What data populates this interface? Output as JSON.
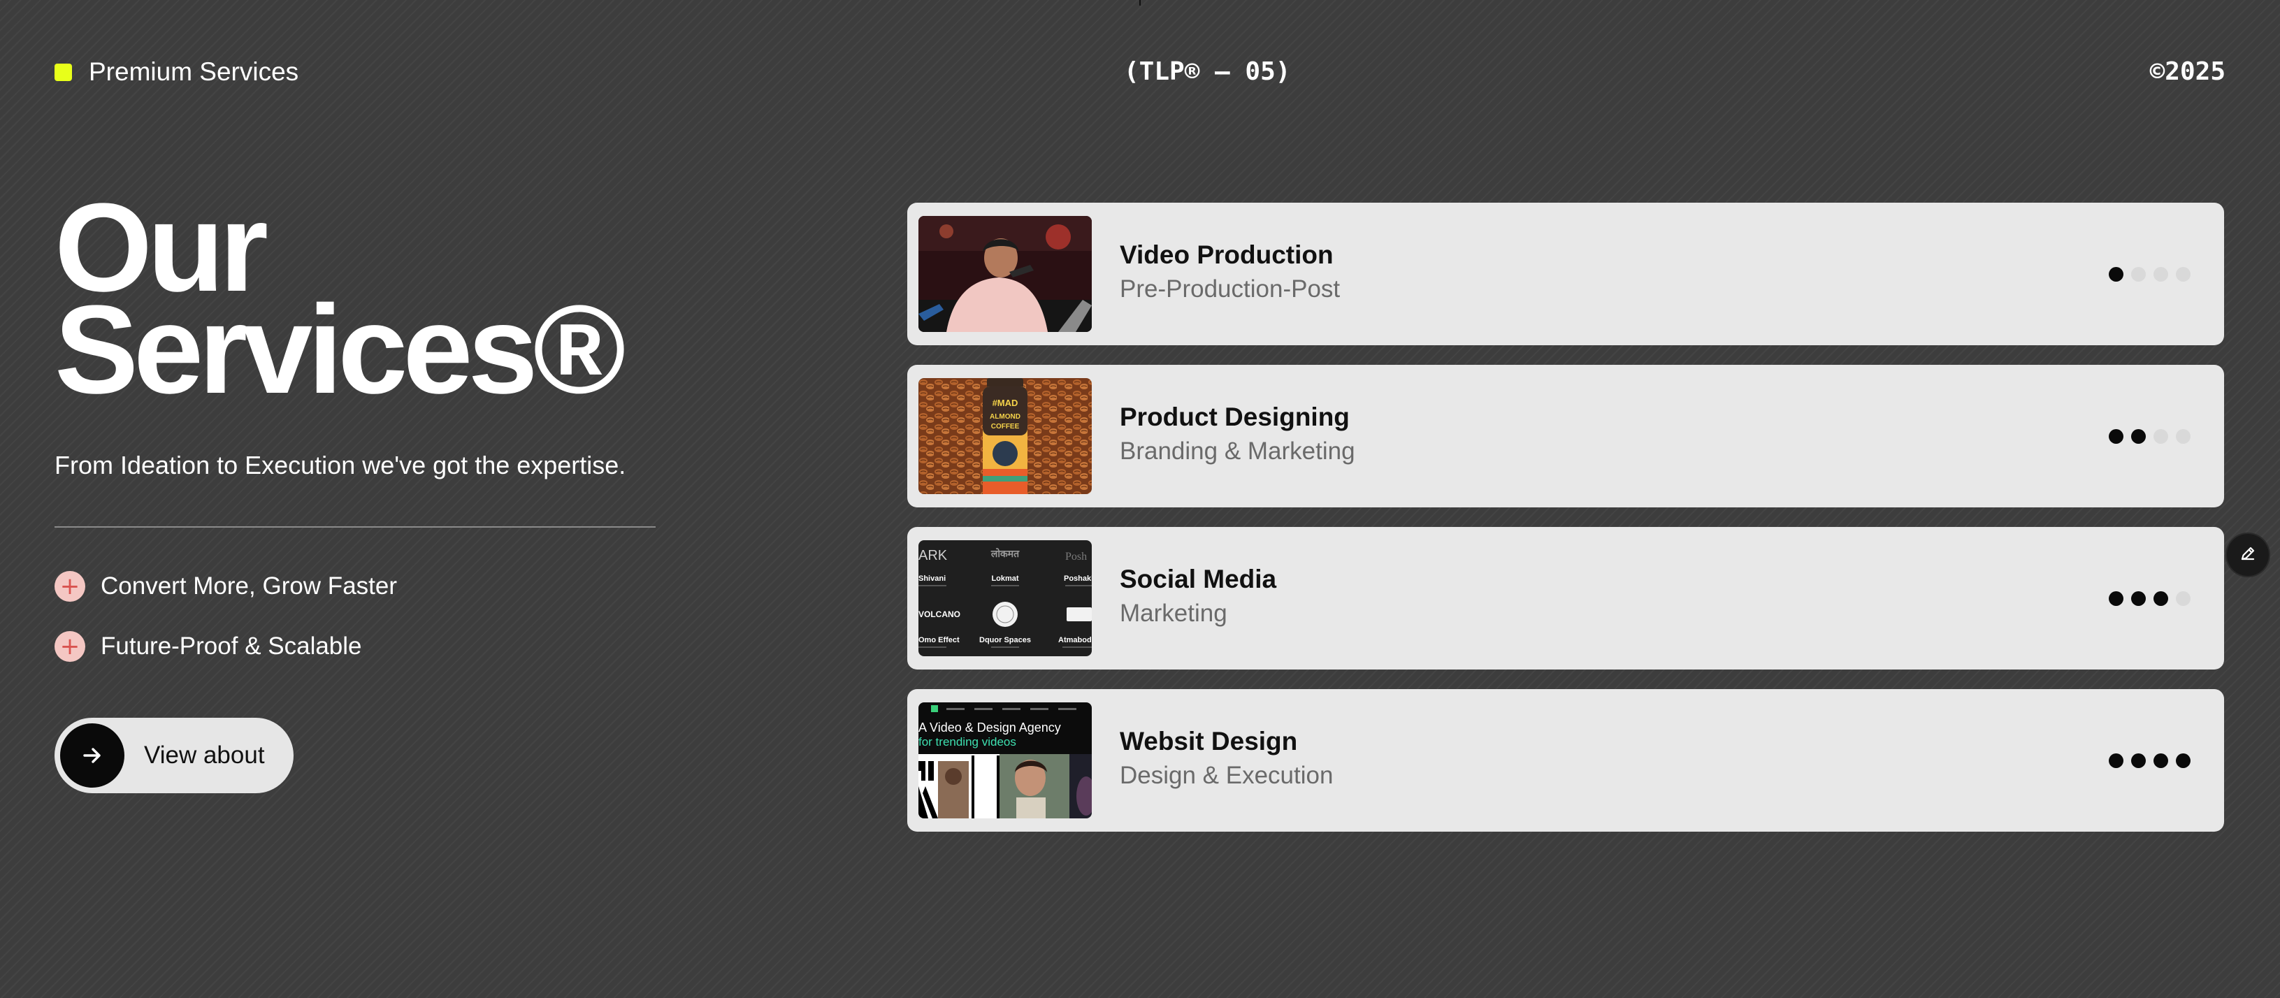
{
  "colors": {
    "accent": "#e8ff1a",
    "card_bg": "#e8e8e8",
    "plus_bg": "#f4c7c3",
    "plus_fg": "#d9534f"
  },
  "header": {
    "label": "Premium Services",
    "code": "(TLP® — 05)",
    "year": "©2025"
  },
  "hero": {
    "title_line1": "Our",
    "title_line2": "Services®",
    "subtitle": "From Ideation to Execution we've got the expertise."
  },
  "features": [
    {
      "icon": "plus-icon",
      "label": "Convert More, Grow Faster"
    },
    {
      "icon": "plus-icon",
      "label": "Future-Proof & Scalable"
    }
  ],
  "cta": {
    "icon": "arrow-right-icon",
    "label": "View about"
  },
  "services": [
    {
      "title": "Video Production",
      "subtitle": "Pre-Production-Post",
      "level": 1,
      "of": 4,
      "thumbnail": "singer-performing-thumbnail"
    },
    {
      "title": "Product Designing",
      "subtitle": "Branding & Marketing",
      "level": 2,
      "of": 4,
      "thumbnail": "coffee-bottle-thumbnail"
    },
    {
      "title": "Social Media",
      "subtitle": "Marketing",
      "level": 3,
      "of": 4,
      "thumbnail": "client-logos-thumbnail"
    },
    {
      "title": "Websit Design",
      "subtitle": "Design & Execution",
      "level": 4,
      "of": 4,
      "thumbnail": "website-mockup-thumbnail"
    }
  ],
  "thumbnail_text": {
    "coffee": [
      "#MAD",
      "ALMOND",
      "COFFEE"
    ],
    "social": [
      "ARK",
      "लोकमत",
      "Posh",
      "Shivani",
      "Lokmat",
      "Poshakh",
      "VOLCANO",
      "Omo Effect",
      "Dquor Spaces",
      "Atmabodh"
    ],
    "website": [
      "A Video & Design Agency",
      "for trending videos"
    ]
  },
  "edit_button": {
    "icon": "pencil-icon"
  }
}
